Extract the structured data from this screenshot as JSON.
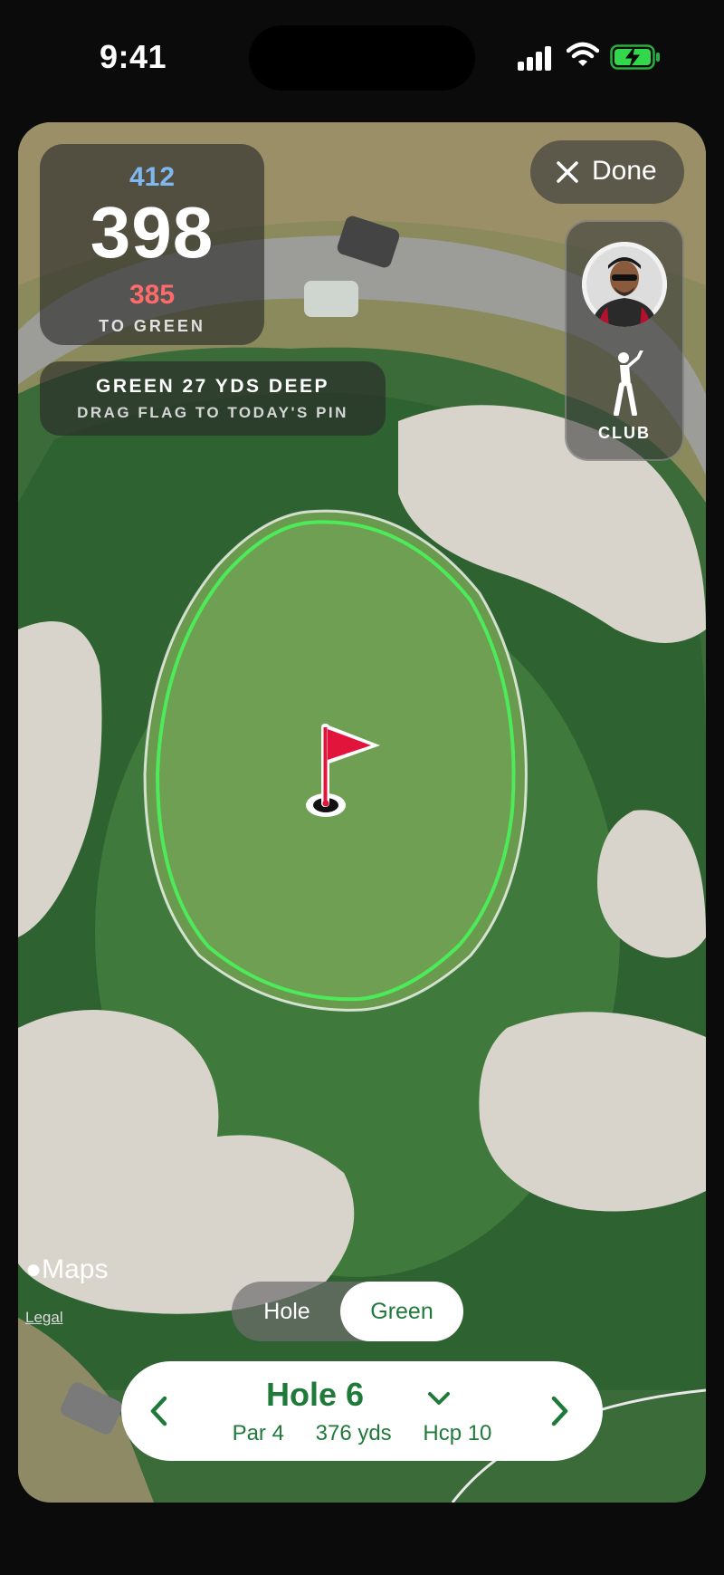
{
  "status_bar": {
    "time": "9:41"
  },
  "distance": {
    "front": "412",
    "main": "398",
    "back": "385",
    "label": "TO GREEN"
  },
  "info": {
    "line1": "GREEN 27 YDS DEEP",
    "line2": "DRAG FLAG TO TODAY'S PIN"
  },
  "done_button": {
    "label": "Done"
  },
  "side_panel": {
    "club_label": "CLUB"
  },
  "map_attribution": {
    "brand": "Maps",
    "legal": "Legal"
  },
  "view_toggle": {
    "options": [
      "Hole",
      "Green"
    ],
    "selected": "Green"
  },
  "hole": {
    "title": "Hole 6",
    "par": "Par 4",
    "yards": "376 yds",
    "handicap": "Hcp 10"
  },
  "colors": {
    "accent_green": "#1f7a3a",
    "green_outline": "#4dea5a",
    "flag_red": "#e3143c",
    "front_blue": "#7fb8f0",
    "back_red": "#ff6b6b"
  }
}
